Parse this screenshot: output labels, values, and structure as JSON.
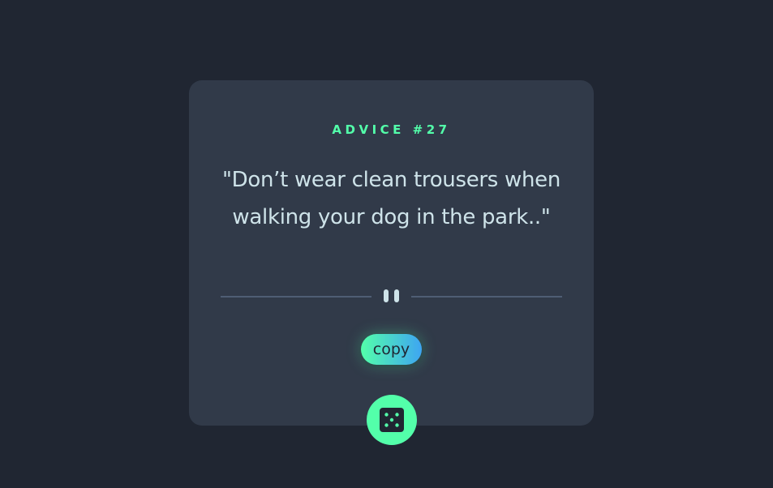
{
  "advice": {
    "id_label": "ADVICE #27",
    "text": "\"Don’t wear clean trousers when walking your dog in the park..\""
  },
  "divider": {
    "icon": "pause-icon"
  },
  "actions": {
    "copy_label": "copy",
    "dice_icon": "dice-icon"
  },
  "colors": {
    "background": "#202632",
    "card": "#313a49",
    "accent": "#53ffaa",
    "text": "#cee3e9",
    "divider": "#4f5d74"
  }
}
